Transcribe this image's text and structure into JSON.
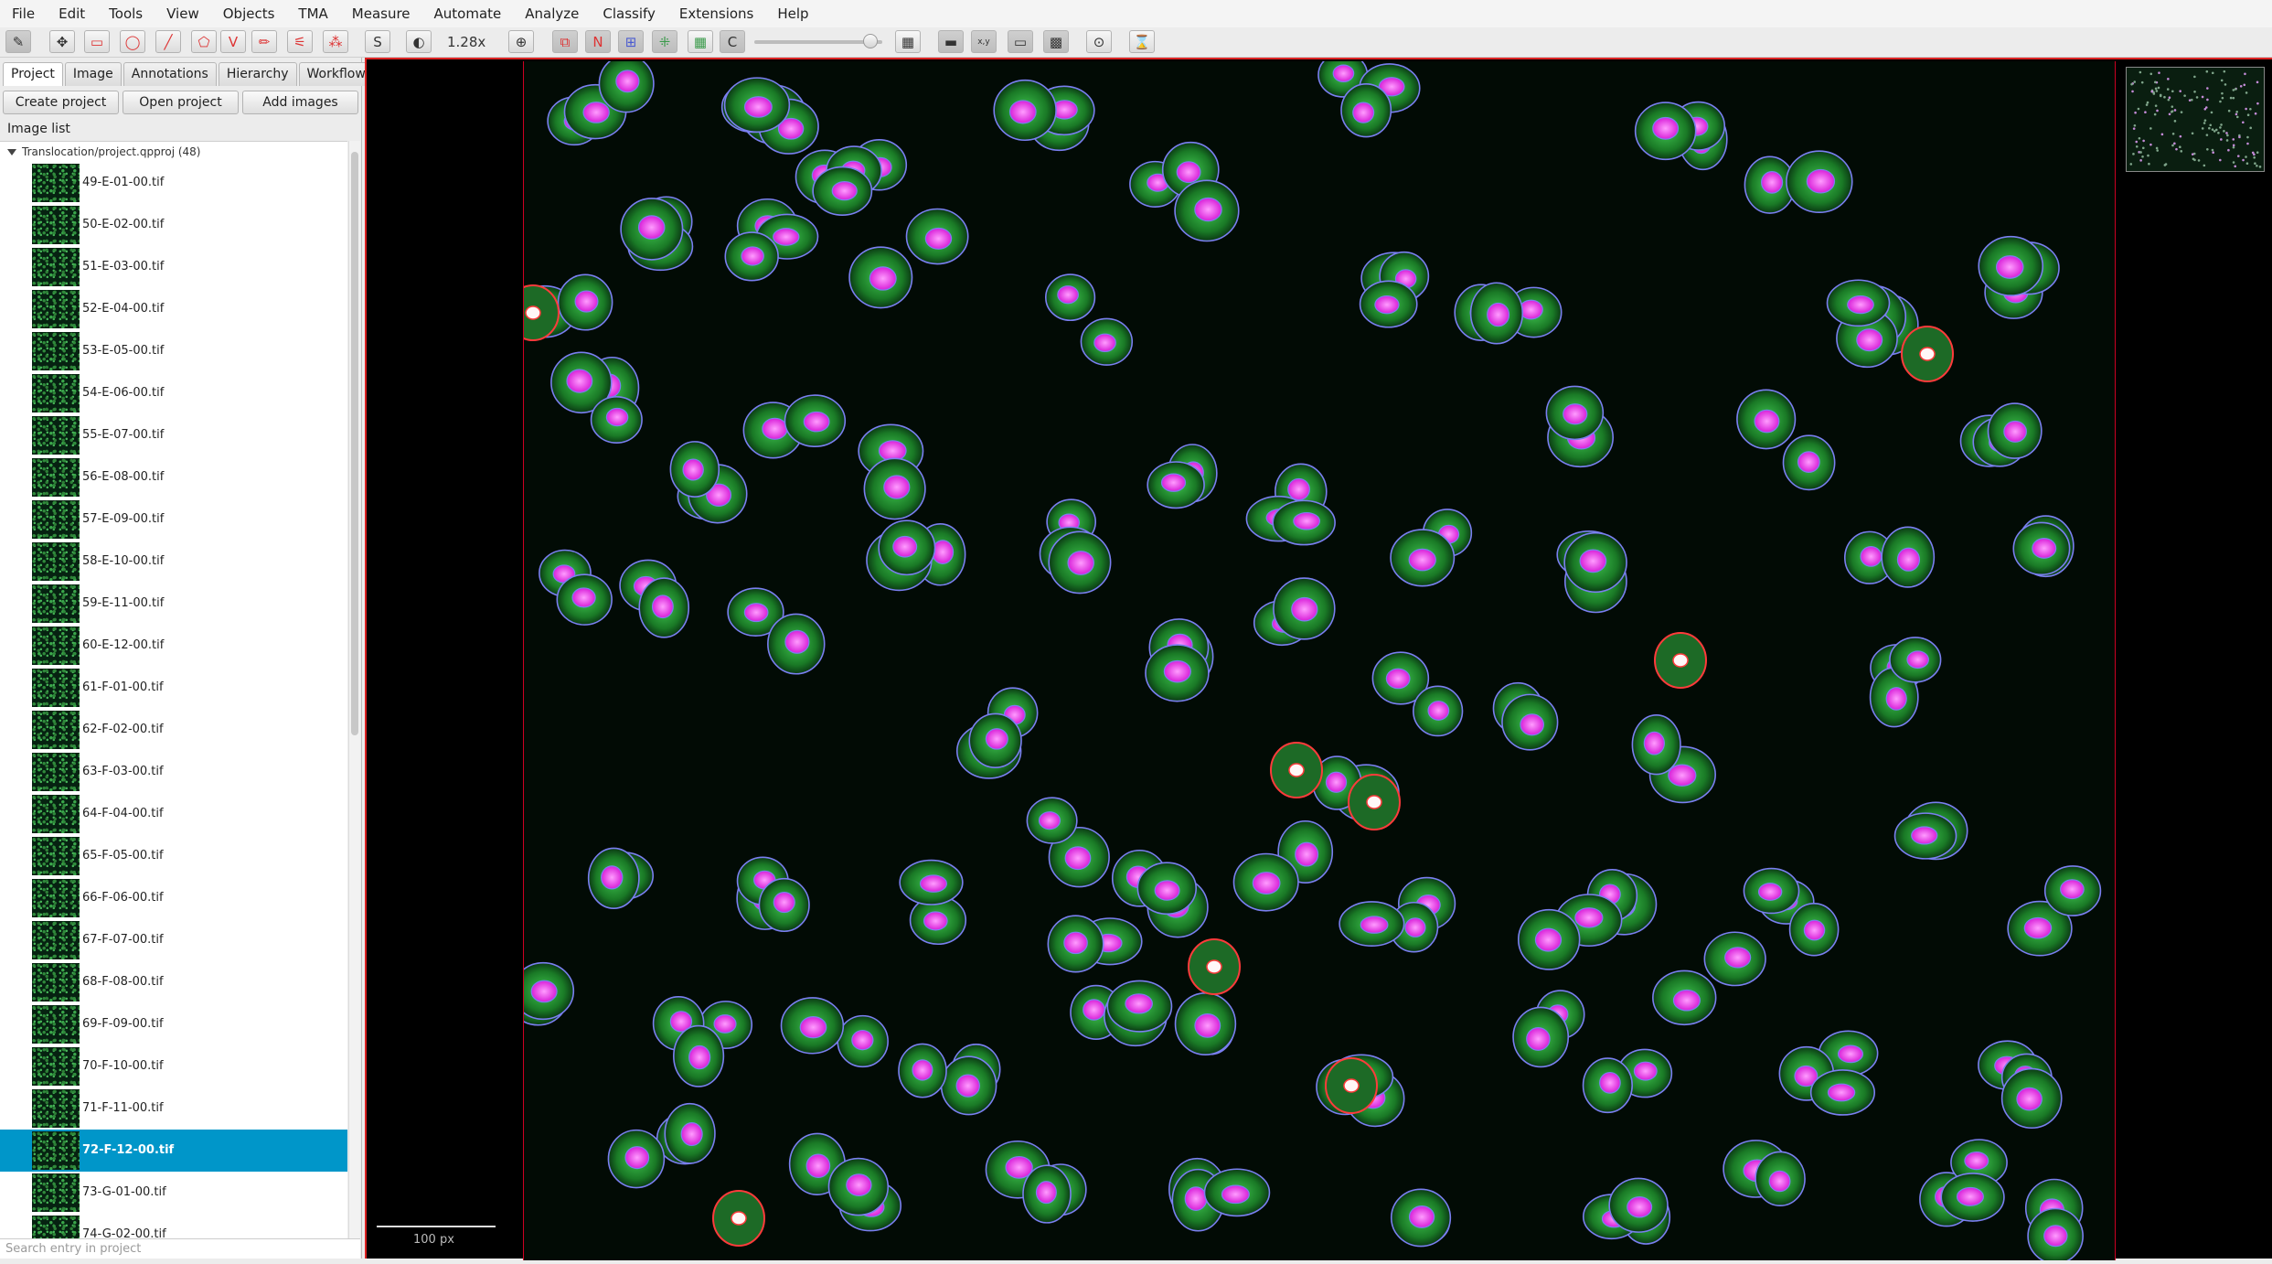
{
  "menubar": [
    "File",
    "Edit",
    "Tools",
    "View",
    "Objects",
    "TMA",
    "Measure",
    "Automate",
    "Analyze",
    "Classify",
    "Extensions",
    "Help"
  ],
  "toolbar": {
    "tools": [
      "move-tool",
      "rectangle-tool",
      "ellipse-tool",
      "line-tool",
      "polygon-tool",
      "polyline-tool",
      "brush-tool",
      "wand-tool",
      "points-tool"
    ],
    "selection_mode_label": "S",
    "zoom": "1.28x",
    "overlay_labels": {
      "n_label": "N",
      "c_label": "C"
    },
    "coords_label": "x,y"
  },
  "tabs": [
    "Project",
    "Image",
    "Annotations",
    "Hierarchy",
    "Workflow"
  ],
  "active_tab": "Project",
  "project_buttons": [
    "Create project",
    "Open project",
    "Add images"
  ],
  "image_list_label": "Image list",
  "project_root": "Translocation/project.qpproj (48)",
  "images": [
    "49-E-01-00.tif",
    "50-E-02-00.tif",
    "51-E-03-00.tif",
    "52-E-04-00.tif",
    "53-E-05-00.tif",
    "54-E-06-00.tif",
    "55-E-07-00.tif",
    "56-E-08-00.tif",
    "57-E-09-00.tif",
    "58-E-10-00.tif",
    "59-E-11-00.tif",
    "60-E-12-00.tif",
    "61-F-01-00.tif",
    "62-F-02-00.tif",
    "63-F-03-00.tif",
    "64-F-04-00.tif",
    "65-F-05-00.tif",
    "66-F-06-00.tif",
    "67-F-07-00.tif",
    "68-F-08-00.tif",
    "69-F-09-00.tif",
    "70-F-10-00.tif",
    "71-F-11-00.tif",
    "72-F-12-00.tif",
    "73-G-01-00.tif",
    "74-G-02-00.tif"
  ],
  "selected_image": "72-F-12-00.tif",
  "search_placeholder": "Search entry in project",
  "viewer": {
    "scale_label": "100 px"
  },
  "colors": {
    "selection": "#0096c9",
    "cell_boundary": "#7a7ff0",
    "nucleus": "#ff33ff",
    "cytoplasm": "#1f9a2c",
    "positive_cell": "#ff3b3b"
  }
}
